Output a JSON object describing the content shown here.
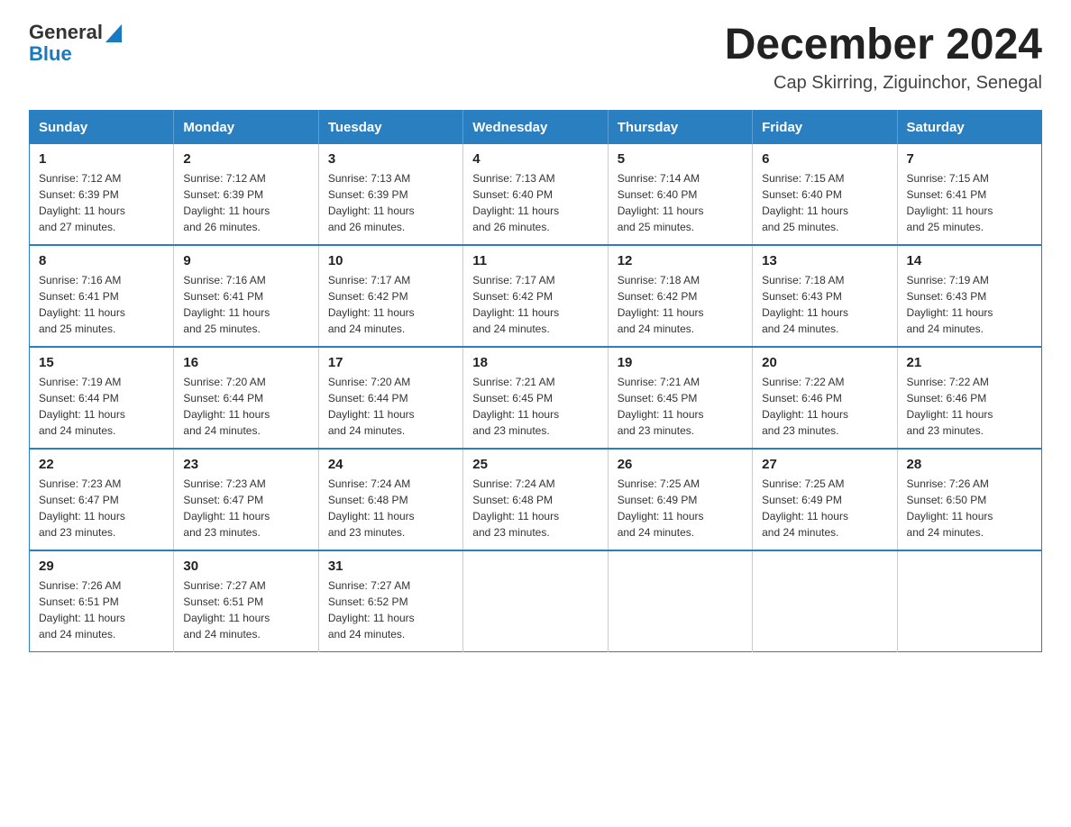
{
  "header": {
    "logo_line1": "General",
    "logo_line2": "Blue",
    "title": "December 2024",
    "subtitle": "Cap Skirring, Ziguinchor, Senegal"
  },
  "calendar": {
    "days_of_week": [
      "Sunday",
      "Monday",
      "Tuesday",
      "Wednesday",
      "Thursday",
      "Friday",
      "Saturday"
    ],
    "weeks": [
      [
        {
          "day": "1",
          "sunrise": "7:12 AM",
          "sunset": "6:39 PM",
          "daylight": "11 hours and 27 minutes."
        },
        {
          "day": "2",
          "sunrise": "7:12 AM",
          "sunset": "6:39 PM",
          "daylight": "11 hours and 26 minutes."
        },
        {
          "day": "3",
          "sunrise": "7:13 AM",
          "sunset": "6:39 PM",
          "daylight": "11 hours and 26 minutes."
        },
        {
          "day": "4",
          "sunrise": "7:13 AM",
          "sunset": "6:40 PM",
          "daylight": "11 hours and 26 minutes."
        },
        {
          "day": "5",
          "sunrise": "7:14 AM",
          "sunset": "6:40 PM",
          "daylight": "11 hours and 25 minutes."
        },
        {
          "day": "6",
          "sunrise": "7:15 AM",
          "sunset": "6:40 PM",
          "daylight": "11 hours and 25 minutes."
        },
        {
          "day": "7",
          "sunrise": "7:15 AM",
          "sunset": "6:41 PM",
          "daylight": "11 hours and 25 minutes."
        }
      ],
      [
        {
          "day": "8",
          "sunrise": "7:16 AM",
          "sunset": "6:41 PM",
          "daylight": "11 hours and 25 minutes."
        },
        {
          "day": "9",
          "sunrise": "7:16 AM",
          "sunset": "6:41 PM",
          "daylight": "11 hours and 25 minutes."
        },
        {
          "day": "10",
          "sunrise": "7:17 AM",
          "sunset": "6:42 PM",
          "daylight": "11 hours and 24 minutes."
        },
        {
          "day": "11",
          "sunrise": "7:17 AM",
          "sunset": "6:42 PM",
          "daylight": "11 hours and 24 minutes."
        },
        {
          "day": "12",
          "sunrise": "7:18 AM",
          "sunset": "6:42 PM",
          "daylight": "11 hours and 24 minutes."
        },
        {
          "day": "13",
          "sunrise": "7:18 AM",
          "sunset": "6:43 PM",
          "daylight": "11 hours and 24 minutes."
        },
        {
          "day": "14",
          "sunrise": "7:19 AM",
          "sunset": "6:43 PM",
          "daylight": "11 hours and 24 minutes."
        }
      ],
      [
        {
          "day": "15",
          "sunrise": "7:19 AM",
          "sunset": "6:44 PM",
          "daylight": "11 hours and 24 minutes."
        },
        {
          "day": "16",
          "sunrise": "7:20 AM",
          "sunset": "6:44 PM",
          "daylight": "11 hours and 24 minutes."
        },
        {
          "day": "17",
          "sunrise": "7:20 AM",
          "sunset": "6:44 PM",
          "daylight": "11 hours and 24 minutes."
        },
        {
          "day": "18",
          "sunrise": "7:21 AM",
          "sunset": "6:45 PM",
          "daylight": "11 hours and 23 minutes."
        },
        {
          "day": "19",
          "sunrise": "7:21 AM",
          "sunset": "6:45 PM",
          "daylight": "11 hours and 23 minutes."
        },
        {
          "day": "20",
          "sunrise": "7:22 AM",
          "sunset": "6:46 PM",
          "daylight": "11 hours and 23 minutes."
        },
        {
          "day": "21",
          "sunrise": "7:22 AM",
          "sunset": "6:46 PM",
          "daylight": "11 hours and 23 minutes."
        }
      ],
      [
        {
          "day": "22",
          "sunrise": "7:23 AM",
          "sunset": "6:47 PM",
          "daylight": "11 hours and 23 minutes."
        },
        {
          "day": "23",
          "sunrise": "7:23 AM",
          "sunset": "6:47 PM",
          "daylight": "11 hours and 23 minutes."
        },
        {
          "day": "24",
          "sunrise": "7:24 AM",
          "sunset": "6:48 PM",
          "daylight": "11 hours and 23 minutes."
        },
        {
          "day": "25",
          "sunrise": "7:24 AM",
          "sunset": "6:48 PM",
          "daylight": "11 hours and 23 minutes."
        },
        {
          "day": "26",
          "sunrise": "7:25 AM",
          "sunset": "6:49 PM",
          "daylight": "11 hours and 24 minutes."
        },
        {
          "day": "27",
          "sunrise": "7:25 AM",
          "sunset": "6:49 PM",
          "daylight": "11 hours and 24 minutes."
        },
        {
          "day": "28",
          "sunrise": "7:26 AM",
          "sunset": "6:50 PM",
          "daylight": "11 hours and 24 minutes."
        }
      ],
      [
        {
          "day": "29",
          "sunrise": "7:26 AM",
          "sunset": "6:51 PM",
          "daylight": "11 hours and 24 minutes."
        },
        {
          "day": "30",
          "sunrise": "7:27 AM",
          "sunset": "6:51 PM",
          "daylight": "11 hours and 24 minutes."
        },
        {
          "day": "31",
          "sunrise": "7:27 AM",
          "sunset": "6:52 PM",
          "daylight": "11 hours and 24 minutes."
        },
        null,
        null,
        null,
        null
      ]
    ]
  }
}
